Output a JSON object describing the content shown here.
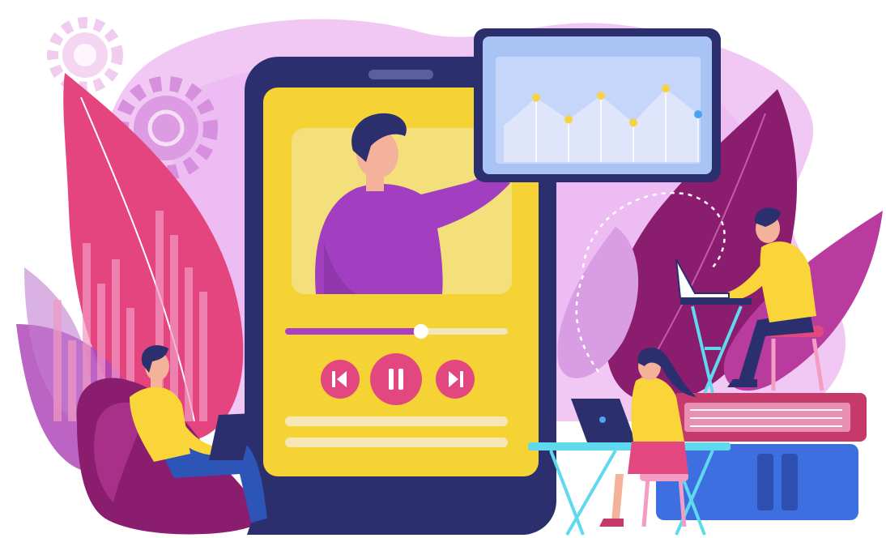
{
  "illustration": {
    "colors": {
      "background": "#ffffff",
      "blob_light": "#f1c8f4",
      "blob_mid": "#e6a7ee",
      "leaf_pink": "#e4457f",
      "leaf_deep": "#8b1d6f",
      "leaf_purple": "#a13fb2",
      "phone_frame": "#2c2f6e",
      "phone_screen": "#f6d335",
      "video_area": "#f3e07a",
      "shirt_purple": "#a23fc0",
      "skin": "#f4b29a",
      "hair": "#2b2f6e",
      "progress_fill": "#a93fc2",
      "progress_track": "#f0e6b8",
      "control_pink": "#e2487f",
      "monitor_frame": "#2c2f6e",
      "monitor_screen": "#a9c3f4",
      "chart_area": "#dfe6fb",
      "dot_yellow": "#f5d341",
      "dot_blue": "#4aa3f0",
      "shirt_yellow": "#f9d53a",
      "jeans": "#2d55b8",
      "desk_cyan": "#5fd9ee",
      "book_red": "#c53a6a",
      "book_blue": "#3e6fe0",
      "laptop": "#2c2f6e"
    },
    "video_progress_fraction": 0.61,
    "monitor_chart_values": [
      0.35,
      0.62,
      0.41,
      0.64,
      0.38,
      0.71,
      0.46
    ],
    "monitor_chart_point_colors": [
      "yellow",
      "yellow",
      "yellow",
      "yellow",
      "yellow",
      "yellow",
      "blue"
    ],
    "icons": {
      "rewind": "rewind-icon",
      "pause": "pause-icon",
      "forward": "fast-forward-icon",
      "gear": "gear-icon"
    }
  }
}
